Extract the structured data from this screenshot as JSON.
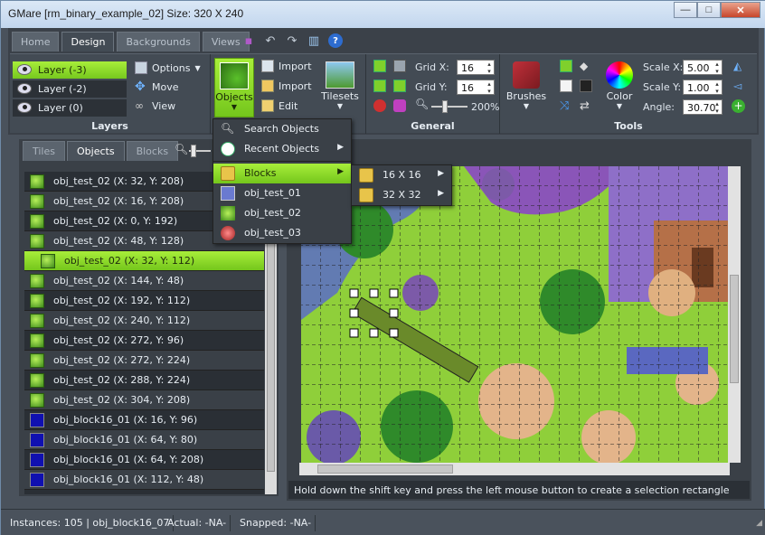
{
  "window": {
    "title": "GMare [rm_binary_example_02] Size: 320 X 240",
    "min": "—",
    "max": "□",
    "close": "✕"
  },
  "ribbon": {
    "tabs": [
      "Home",
      "Design",
      "Backgrounds",
      "Views"
    ],
    "active_tab": "Design",
    "layers": {
      "items": [
        "Layer (-3)",
        "Layer (-2)",
        "Layer (0)"
      ],
      "label": "Layers",
      "options": "Options",
      "move": "Move",
      "view": "View"
    },
    "objects_btn": "Objects",
    "import1": "Import",
    "import2": "Import",
    "edit": "Edit",
    "tilesets": "Tilesets",
    "general": {
      "label": "General",
      "grid_x_label": "Grid X:",
      "grid_x": "16",
      "grid_y_label": "Grid Y:",
      "grid_y": "16",
      "zoom": "200%"
    },
    "tools": {
      "label": "Tools",
      "brushes": "Brushes",
      "color": "Color",
      "scale_x_label": "Scale X:",
      "scale_x": "5.00",
      "scale_y_label": "Scale Y:",
      "scale_y": "1.00",
      "angle_label": "Angle:",
      "angle": "30.70"
    }
  },
  "left_panel": {
    "tabs": [
      "Tiles",
      "Objects",
      "Blocks"
    ],
    "active_tab": "Objects",
    "rows": [
      {
        "text": "obj_test_02 (X: 32, Y: 208)",
        "icon": "tree"
      },
      {
        "text": "obj_test_02 (X: 16, Y: 208)",
        "icon": "tree"
      },
      {
        "text": "obj_test_02 (X: 0, Y: 192)",
        "icon": "tree"
      },
      {
        "text": "obj_test_02 (X: 48, Y: 128)",
        "icon": "tree"
      },
      {
        "text": "obj_test_02 (X: 32, Y: 112)",
        "icon": "tree",
        "selected": true
      },
      {
        "text": "obj_test_02 (X: 144, Y: 48)",
        "icon": "tree"
      },
      {
        "text": "obj_test_02 (X: 192, Y: 112)",
        "icon": "tree"
      },
      {
        "text": "obj_test_02 (X: 240, Y: 112)",
        "icon": "tree"
      },
      {
        "text": "obj_test_02 (X: 272, Y: 96)",
        "icon": "tree"
      },
      {
        "text": "obj_test_02 (X: 272, Y: 224)",
        "icon": "tree"
      },
      {
        "text": "obj_test_02 (X: 288, Y: 224)",
        "icon": "tree"
      },
      {
        "text": "obj_test_02 (X: 304, Y: 208)",
        "icon": "tree"
      },
      {
        "text": "obj_block16_01 (X: 16, Y: 96)",
        "icon": "block"
      },
      {
        "text": "obj_block16_01 (X: 64, Y: 80)",
        "icon": "block"
      },
      {
        "text": "obj_block16_01 (X: 64, Y: 208)",
        "icon": "block"
      },
      {
        "text": "obj_block16_01 (X: 112, Y: 48)",
        "icon": "block"
      }
    ]
  },
  "menu": {
    "items": [
      "Search Objects",
      "Recent Objects",
      "Blocks",
      "obj_test_01",
      "obj_test_02",
      "obj_test_03"
    ],
    "submenu": [
      "16 X 16",
      "32 X 32"
    ]
  },
  "hint": "Hold down the shift key and press the left mouse button to create a selection rectangle",
  "status": {
    "instances": "Instances: 105 | obj_block16_07",
    "actual": "Actual: -NA-",
    "snapped": "Snapped: -NA-"
  },
  "colors": {
    "accent": "#8fdc2a",
    "dark": "#3a4047"
  }
}
